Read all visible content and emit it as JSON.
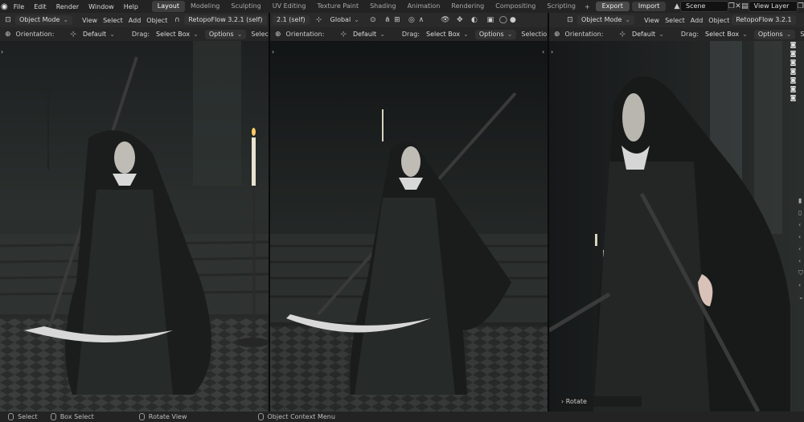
{
  "menus": [
    "File",
    "Edit",
    "Render",
    "Window",
    "Help"
  ],
  "workspace_tabs": [
    {
      "label": "Layout",
      "active": true
    },
    {
      "label": "Modeling",
      "active": false
    },
    {
      "label": "Sculpting",
      "active": false
    },
    {
      "label": "UV Editing",
      "active": false
    },
    {
      "label": "Texture Paint",
      "active": false
    },
    {
      "label": "Shading",
      "active": false
    },
    {
      "label": "Animation",
      "active": false
    },
    {
      "label": "Rendering",
      "active": false
    },
    {
      "label": "Compositing",
      "active": false
    },
    {
      "label": "Scripting",
      "active": false
    }
  ],
  "top_right": {
    "export_label": "Export",
    "import_label": "Import",
    "scene": "Scene",
    "view_layer": "View Layer"
  },
  "viewports": [
    {
      "mode": "Object Mode",
      "menus": [
        "View",
        "Select",
        "Add",
        "Object"
      ],
      "addon": "RetopoFlow 3.2.1 (self)",
      "addon_extra": "2.1 (self)",
      "transform": "Global",
      "orientation_label": "Orientation:",
      "orientation_value": "Default",
      "drag_label": "Drag:",
      "drag_value": "Select Box",
      "options_label": "Options",
      "selection_label": "Selection Se"
    },
    {
      "mode": "",
      "menus": [],
      "addon": "",
      "addon_extra": "",
      "transform": "",
      "orientation_label": "Orientation:",
      "orientation_value": "Default",
      "drag_label": "Drag:",
      "drag_value": "Select Box",
      "options_label": "Options",
      "selection_label": "Selection Set E"
    },
    {
      "mode": "Object Mode",
      "menus": [
        "View",
        "Select",
        "Add",
        "Object"
      ],
      "addon": "RetopoFlow 3.2.1",
      "addon_extra": "",
      "transform": "",
      "orientation_label": "Orientation:",
      "orientation_value": "Default",
      "drag_label": "Drag:",
      "drag_value": "Select Box",
      "options_label": "Options",
      "selection_label": "S"
    }
  ],
  "operator_label": "Rotate",
  "status": [
    {
      "label": "Select",
      "icon": "mouse-left-icon"
    },
    {
      "label": "Box Select",
      "icon": "mouse-left-icon"
    },
    {
      "label": "Rotate View",
      "icon": "mouse-middle-icon"
    },
    {
      "label": "Object Context Menu",
      "icon": "mouse-right-icon"
    }
  ],
  "colors": {
    "accent": "#3d3d3d",
    "topbar": "#232323",
    "header": "#2a2a2a",
    "scythe": "#d8d8d8",
    "candle_flame": "#ffcc66"
  }
}
